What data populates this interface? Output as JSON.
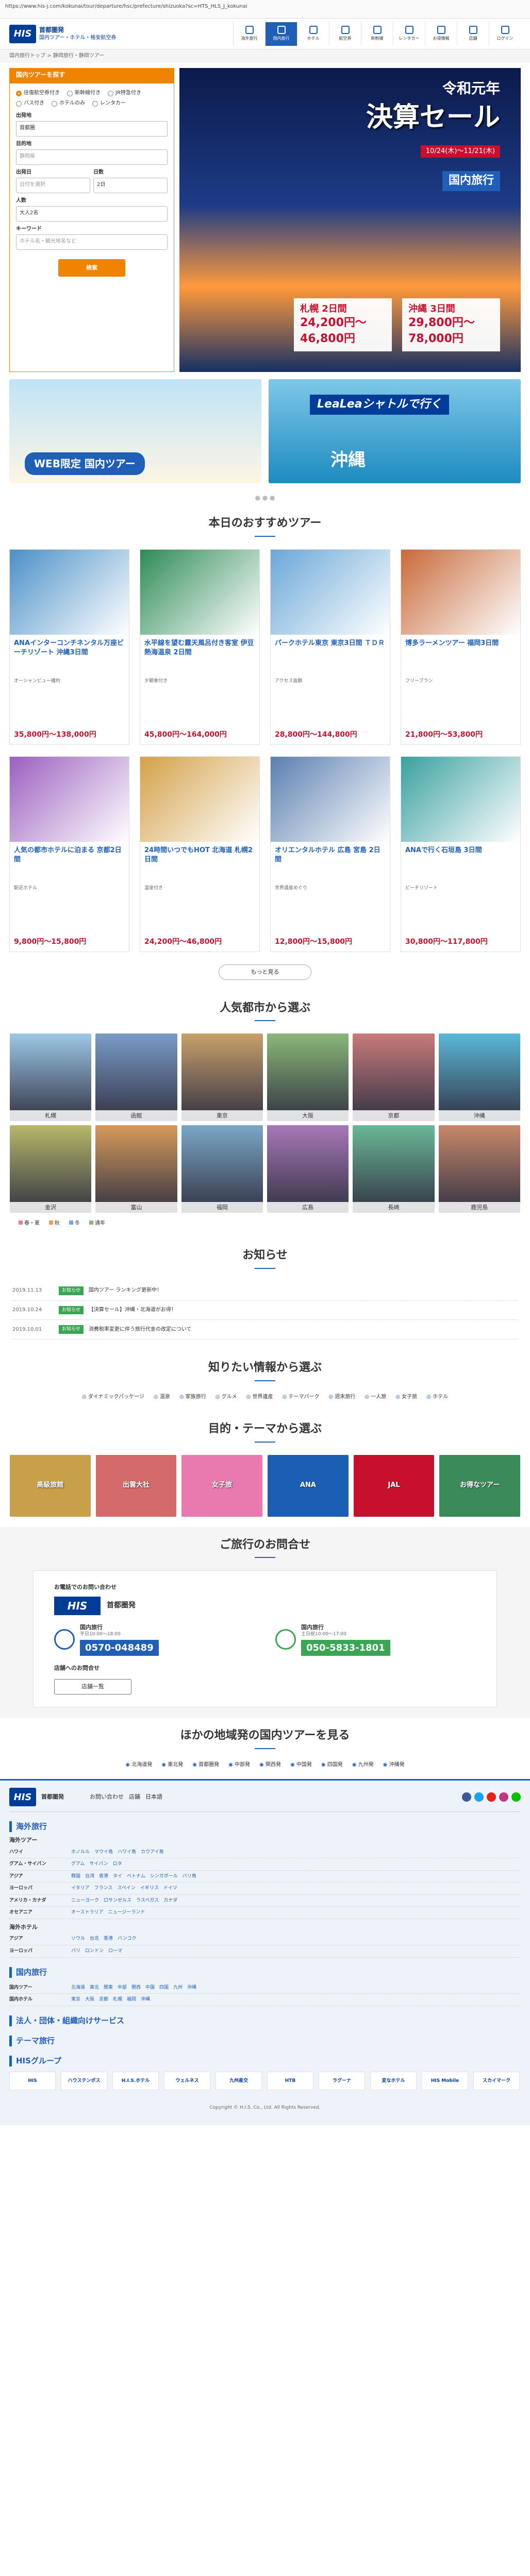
{
  "urlbar": "https://www.his-j.com/kokunai/tour/departure/hsc/prefecture/shizuoka?sc=HTS_HLS_J_kokunai",
  "header": {
    "logo": "HIS",
    "brand_name": "首都圏発",
    "brand_sub": "国内ツアー・ホテル・格安航空券",
    "nav": [
      {
        "label": "海外旅行",
        "active": false
      },
      {
        "label": "国内旅行",
        "active": true
      },
      {
        "label": "ホテル",
        "active": false
      },
      {
        "label": "航空券",
        "active": false
      },
      {
        "label": "新幹線",
        "active": false
      },
      {
        "label": "レンタカー",
        "active": false
      },
      {
        "label": "お得情報",
        "active": false
      },
      {
        "label": "店舗",
        "active": false
      },
      {
        "label": "ログイン",
        "active": false
      }
    ]
  },
  "breadcrumb": "国内旅行トップ > 静岡旅行・静岡ツアー",
  "search": {
    "title": "国内ツアーを探す",
    "radios": [
      "往復航空券付き",
      "新幹線付き",
      "JR特急付き",
      "バス付き",
      "ホテルのみ",
      "レンタカー"
    ],
    "from_label": "出発地",
    "from_value": "首都圏",
    "to_label": "目的地",
    "to_placeholder": "静岡県",
    "date_label": "出発日",
    "date_placeholder": "日付を選択",
    "days_label": "日数",
    "days_value": "2日",
    "people_label": "人数",
    "people_value": "大人2名",
    "keyword_label": "キーワード",
    "keyword_placeholder": "ホテル名・観光地名など",
    "button": "検索"
  },
  "banner": {
    "era": "令和元年",
    "title": "決算セール",
    "period": "10/24(木)〜11/21(木)",
    "category": "国内旅行",
    "city1": "札幌 2日間",
    "price1": "24,200円〜46,800円",
    "city2": "沖縄 3日間",
    "price2": "29,800円〜78,000円"
  },
  "promo": {
    "web_limited": "WEB限定 国内ツアー",
    "lealea": "LeaLeaシャトルで行く",
    "okinawa": "沖縄"
  },
  "recommended": {
    "title": "本日のおすすめツアー",
    "more": "もっと見る",
    "tours": [
      {
        "title": "ANAインターコンチネンタル万座ビーチリゾート 沖縄3日間",
        "desc": "オーシャンビュー確約",
        "price": "35,800円〜138,000円"
      },
      {
        "title": "水平線を望む露天風呂付き客室 伊豆 熱海温泉 2日間",
        "desc": "夕朝食付き",
        "price": "45,800円〜164,000円"
      },
      {
        "title": "パークホテル東京 東京3日間 ＴＤＲ",
        "desc": "アクセス抜群",
        "price": "28,800円〜144,800円"
      },
      {
        "title": "博多ラーメンツアー 福岡3日間",
        "desc": "フリープラン",
        "price": "21,800円〜53,800円"
      },
      {
        "title": "人気の都市ホテルに泊まる 京都2日間",
        "desc": "駅近ホテル",
        "price": "9,800円〜15,800円"
      },
      {
        "title": "24時間いつでもHOT 北海道 札幌2日間",
        "desc": "温泉付き",
        "price": "24,200円〜46,800円"
      },
      {
        "title": "オリエンタルホテル 広島 宮島 2日間",
        "desc": "世界遺産めぐり",
        "price": "12,800円〜15,800円"
      },
      {
        "title": "ANAで行く石垣島 3日間",
        "desc": "ビーチリゾート",
        "price": "30,800円〜117,800円"
      }
    ]
  },
  "popular_cities": {
    "title": "人気都市から選ぶ",
    "cities": [
      "札幌",
      "函館",
      "東京",
      "大阪",
      "京都",
      "沖縄",
      "金沢",
      "富山",
      "福岡",
      "広島",
      "長崎",
      "鹿児島"
    ],
    "legend": [
      "春・夏",
      "秋",
      "冬",
      "通年"
    ]
  },
  "news": {
    "title": "お知らせ",
    "items": [
      {
        "date": "2019.11.13",
        "tag": "お知らせ",
        "text": "国内ツアー ランキング更新中！"
      },
      {
        "date": "2019.10.24",
        "tag": "お知らせ",
        "text": "【決算セール】沖縄・北海道がお得！"
      },
      {
        "date": "2019.10.01",
        "tag": "お知らせ",
        "text": "消費税率変更に伴う旅行代金の改定について"
      }
    ]
  },
  "info": {
    "title": "知りたい情報から選ぶ",
    "items": [
      "ダイナミックパッケージ",
      "温泉",
      "家族旅行",
      "グルメ",
      "世界遺産",
      "テーマパーク",
      "週末旅行",
      "一人旅",
      "女子旅",
      "ホテル"
    ]
  },
  "themes": {
    "title": "目的・テーマから選ぶ",
    "items": [
      "高級旅館",
      "出雲大社",
      "女子旅",
      "ANA",
      "JAL",
      "お得なツアー"
    ]
  },
  "shop": {
    "title": "ご旅行のお問合せ",
    "subtitle": "お電話でのお問い合わせ",
    "logo": "HIS",
    "shop_name": "首都圏発",
    "phone1_label": "国内旅行",
    "phone1_hours": "平日10:00〜18:00",
    "phone1": "0570-048489",
    "phone2_label": "国内旅行",
    "phone2_hours": "土日祝10:00〜17:00",
    "phone2": "050-5833-1801",
    "shop_note": "店舗へのお問合せ",
    "shop_button": "店舗一覧"
  },
  "regions": {
    "title": "ほかの地域発の国内ツアーを見る",
    "items": [
      "北海道発",
      "東北発",
      "首都圏発",
      "中部発",
      "関西発",
      "中国発",
      "四国発",
      "九州発",
      "沖縄発"
    ]
  },
  "footer": {
    "logo": "HIS",
    "brand": "首都圏発",
    "contact": "お問い合わせ",
    "shops": "店舗",
    "lang": "日本語",
    "sec_overseas": "海外旅行",
    "sub_tours": "海外ツアー",
    "overseas_rows": [
      {
        "k": "ハワイ",
        "v": "ホノルル　マウイ島　ハワイ島　カウアイ島"
      },
      {
        "k": "グアム・サイパン",
        "v": "グアム　サイパン　ロタ"
      },
      {
        "k": "アジア",
        "v": "韓国　台湾　香港　タイ　ベトナム　シンガポール　バリ島"
      },
      {
        "k": "ヨーロッパ",
        "v": "イタリア　フランス　スペイン　イギリス　ドイツ"
      },
      {
        "k": "アメリカ・カナダ",
        "v": "ニューヨーク　ロサンゼルス　ラスベガス　カナダ"
      },
      {
        "k": "オセアニア",
        "v": "オーストラリア　ニュージーランド"
      }
    ],
    "sub_hotels": "海外ホテル",
    "hotel_rows": [
      {
        "k": "アジア",
        "v": "ソウル　台北　香港　バンコク"
      },
      {
        "k": "ヨーロッパ",
        "v": "パリ　ロンドン　ローマ"
      }
    ],
    "sec_domestic": "国内旅行",
    "domestic_rows": [
      {
        "k": "国内ツアー",
        "v": "北海道　東北　関東　中部　関西　中国　四国　九州　沖縄"
      },
      {
        "k": "国内ホテル",
        "v": "東京　大阪　京都　札幌　福岡　沖縄"
      }
    ],
    "sec_corp": "法人・団体・組織向けサービス",
    "sec_theme": "テーマ旅行",
    "sec_group": "HISグループ",
    "group": [
      "HIS",
      "ハウステンボス",
      "H.I.S.ホテル",
      "ウェルネス",
      "九州産交",
      "HTB",
      "ラグーナ",
      "変なホテル",
      "HIS Mobile",
      "スカイマーク"
    ],
    "copyright": "Copyright © H.I.S. Co., Ltd. All Rights Reserved."
  }
}
